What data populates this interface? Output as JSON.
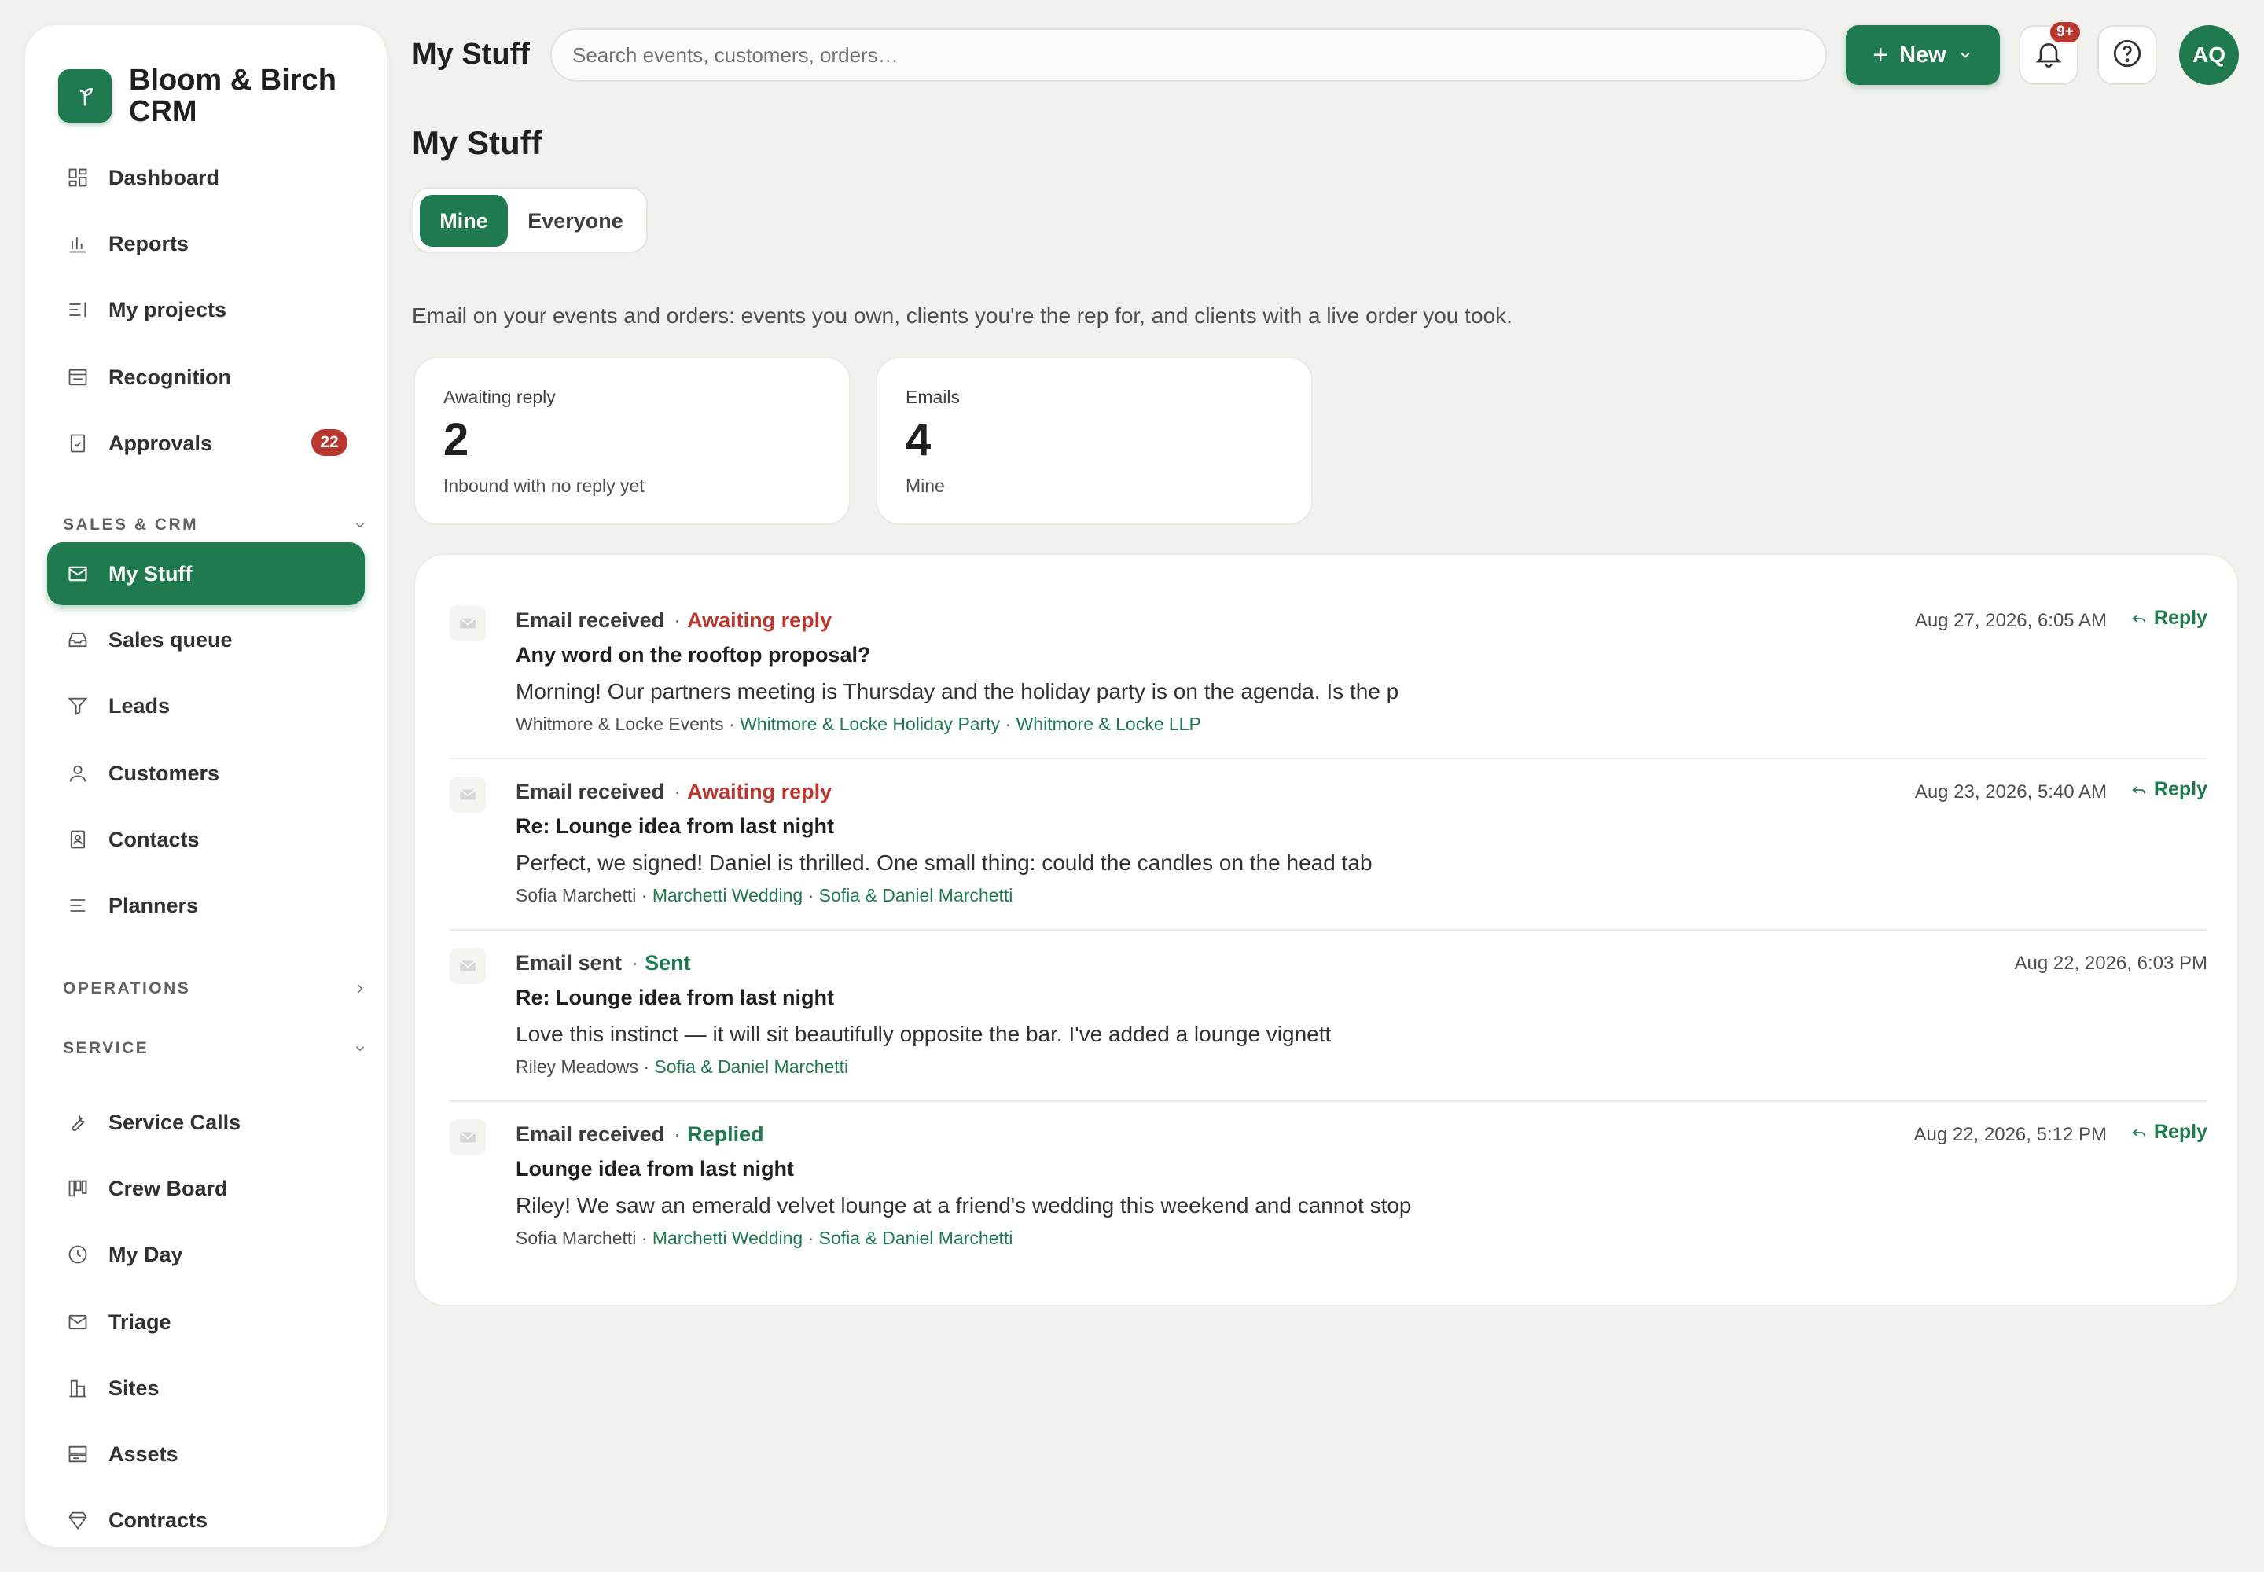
{
  "app": {
    "brand_name": "Bloom & Birch CRM",
    "accent_color": "#1f7a4f",
    "alert_color": "#b8372f"
  },
  "sidebar": {
    "items_top": [
      {
        "label": "Dashboard",
        "icon": "dashboard-icon"
      },
      {
        "label": "Reports",
        "icon": "bar-chart-icon"
      },
      {
        "label": "My projects",
        "icon": "projects-icon"
      },
      {
        "label": "Recognition",
        "icon": "recognition-icon"
      },
      {
        "label": "Approvals",
        "icon": "clipboard-check-icon",
        "badge": "22"
      }
    ],
    "sections": [
      {
        "label": "SALES & CRM",
        "state": "expanded"
      },
      {
        "label": "OPERATIONS",
        "state": "collapsed"
      },
      {
        "label": "SERVICE",
        "state": "expanded"
      }
    ],
    "sales_items": [
      {
        "label": "My Stuff",
        "icon": "mail-icon",
        "active": true
      },
      {
        "label": "Sales queue",
        "icon": "inbox-icon"
      },
      {
        "label": "Leads",
        "icon": "funnel-icon"
      },
      {
        "label": "Customers",
        "icon": "person-icon"
      },
      {
        "label": "Contacts",
        "icon": "contact-card-icon"
      },
      {
        "label": "Planners",
        "icon": "lines-icon"
      }
    ],
    "service_items": [
      {
        "label": "Service Calls",
        "icon": "wrench-icon"
      },
      {
        "label": "Crew Board",
        "icon": "board-icon"
      },
      {
        "label": "My Day",
        "icon": "clock-icon"
      },
      {
        "label": "Triage",
        "icon": "mail-icon"
      },
      {
        "label": "Sites",
        "icon": "building-icon"
      },
      {
        "label": "Assets",
        "icon": "storage-icon"
      },
      {
        "label": "Contracts",
        "icon": "diamond-icon"
      }
    ]
  },
  "topbar": {
    "title": "My Stuff",
    "search_placeholder": "Search events, customers, orders…",
    "new_label": "New",
    "notification_count": "9+",
    "avatar_initials": "AQ"
  },
  "main": {
    "title": "My Stuff",
    "tabs": [
      {
        "label": "Mine",
        "active": true
      },
      {
        "label": "Everyone",
        "active": false
      }
    ],
    "description": "Email on your events and orders: events you own, clients you're the rep for, and clients with a live order you took.",
    "stats": [
      {
        "label": "Awaiting reply",
        "value": "2",
        "sub": "Inbound with no reply yet"
      },
      {
        "label": "Emails",
        "value": "4",
        "sub": "Mine"
      }
    ]
  },
  "feed": [
    {
      "kind": "Email received",
      "status": "Awaiting reply",
      "status_type": "await",
      "subject": "Any word on the rooftop proposal?",
      "preview": "Morning! Our partners meeting is Thursday and the holiday party is on the agenda. Is the p",
      "meta_from": "Whitmore & Locke Events",
      "meta_links": [
        "Whitmore & Locke Holiday Party",
        "Whitmore & Locke LLP"
      ],
      "time": "Aug 27, 2026, 6:05 AM",
      "reply_label": "Reply"
    },
    {
      "kind": "Email received",
      "status": "Awaiting reply",
      "status_type": "await",
      "subject": "Re: Lounge idea from last night",
      "preview": "Perfect, we signed! Daniel is thrilled. One small thing: could the candles on the head tab",
      "meta_from": "Sofia Marchetti",
      "meta_links": [
        "Marchetti Wedding",
        "Sofia & Daniel Marchetti"
      ],
      "time": "Aug 23, 2026, 5:40 AM",
      "reply_label": "Reply"
    },
    {
      "kind": "Email sent",
      "status": "Sent",
      "status_type": "green",
      "subject": "Re: Lounge idea from last night",
      "preview": "Love this instinct — it will sit beautifully opposite the bar. I've added a lounge vignett",
      "meta_from": "Riley Meadows",
      "meta_links": [
        "Sofia & Daniel Marchetti"
      ],
      "time": "Aug 22, 2026, 6:03 PM",
      "reply_label": ""
    },
    {
      "kind": "Email received",
      "status": "Replied",
      "status_type": "green",
      "subject": "Lounge idea from last night",
      "preview": "Riley! We saw an emerald velvet lounge at a friend's wedding this weekend and cannot stop",
      "meta_from": "Sofia Marchetti",
      "meta_links": [
        "Marchetti Wedding",
        "Sofia & Daniel Marchetti"
      ],
      "time": "Aug 22, 2026, 5:12 PM",
      "reply_label": "Reply"
    }
  ]
}
